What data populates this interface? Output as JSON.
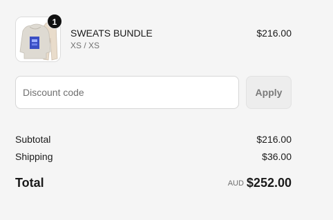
{
  "line_item": {
    "quantity": "1",
    "name": "SWEATS BUNDLE",
    "variant": "XS / XS",
    "price": "$216.00",
    "image_icon": "hoodie-and-sweatpants-product-image"
  },
  "discount": {
    "placeholder": "Discount code",
    "value": "",
    "apply_label": "Apply"
  },
  "totals": {
    "subtotal_label": "Subtotal",
    "subtotal_value": "$216.00",
    "shipping_label": "Shipping",
    "shipping_value": "$36.00",
    "total_label": "Total",
    "currency": "AUD",
    "total_value": "$252.00"
  },
  "colors": {
    "background": "#f5f5f5",
    "badge": "#111111",
    "apply_button_bg": "#ededed",
    "muted_text": "#707070"
  }
}
